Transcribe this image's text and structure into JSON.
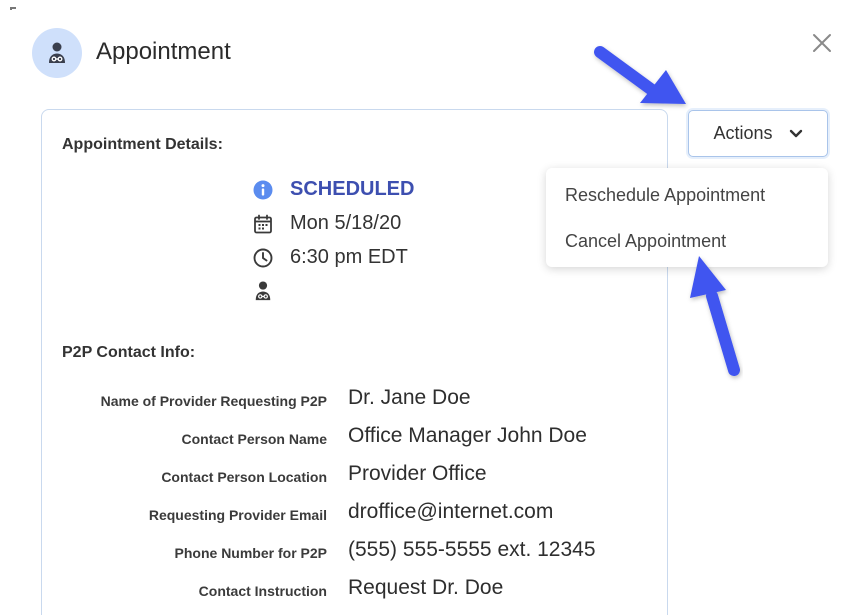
{
  "dialog": {
    "title": "Appointment",
    "close_icon": "close-icon",
    "avatar_icon": "doctor-icon"
  },
  "appointment_details": {
    "heading": "Appointment Details:",
    "status": "SCHEDULED",
    "status_icon": "info-icon",
    "date": "Mon 5/18/20",
    "date_icon": "calendar-icon",
    "time": "6:30 pm EDT",
    "time_icon": "clock-icon",
    "provider_icon": "doctor-icon"
  },
  "p2p_contact": {
    "heading": "P2P Contact Info:",
    "rows": [
      {
        "label": "Name of Provider Requesting P2P",
        "value": "Dr. Jane Doe"
      },
      {
        "label": "Contact Person Name",
        "value": "Office Manager John Doe"
      },
      {
        "label": "Contact Person Location",
        "value": "Provider Office"
      },
      {
        "label": "Requesting Provider Email",
        "value": "droffice@internet.com"
      },
      {
        "label": "Phone Number for P2P",
        "value": "(555) 555-5555 ext. 12345"
      },
      {
        "label": "Contact Instruction",
        "value": "Request Dr. Doe"
      }
    ]
  },
  "actions": {
    "label": "Actions",
    "icon": "chevron-down-icon",
    "menu": [
      {
        "label": "Reschedule Appointment"
      },
      {
        "label": "Cancel Appointment"
      }
    ]
  },
  "colors": {
    "accent": "#3d4fb0",
    "avatar_bg": "#cfe0fb",
    "annotation_arrow": "#3f55f0",
    "info_icon": "#5b8cef"
  }
}
